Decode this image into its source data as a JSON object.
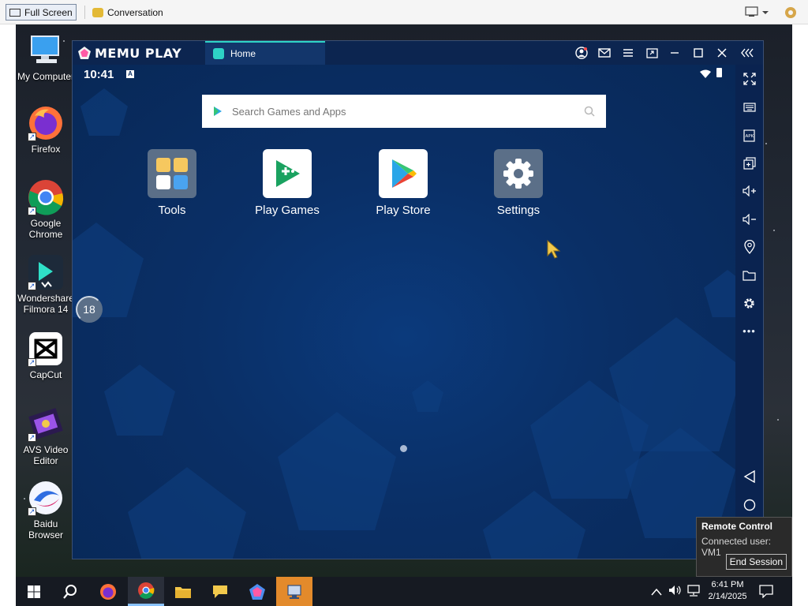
{
  "viewer_bar": {
    "fullscreen_label": "Full Screen",
    "conversation_label": "Conversation"
  },
  "desktop": {
    "icons": [
      {
        "label": "My Computer",
        "icon": "monitor-icon"
      },
      {
        "label": "Firefox",
        "icon": "firefox-icon"
      },
      {
        "label": "Google Chrome",
        "icon": "chrome-icon"
      },
      {
        "label": "Wondershare Filmora 14",
        "icon": "filmora-icon"
      },
      {
        "label": "CapCut",
        "icon": "capcut-icon"
      },
      {
        "label": "AVS Video Editor",
        "icon": "avs-icon"
      },
      {
        "label": "Baidu Browser",
        "icon": "baidu-icon"
      }
    ]
  },
  "memu": {
    "logo_text": "MEMU PLAY",
    "tab_label": "Home",
    "status_time": "10:41",
    "search_placeholder": "Search Games and Apps",
    "apps": [
      {
        "label": "Tools",
        "icon": "tools-icon"
      },
      {
        "label": "Play Games",
        "icon": "play-games-icon"
      },
      {
        "label": "Play Store",
        "icon": "play-store-icon"
      },
      {
        "label": "Settings",
        "icon": "settings-gear-icon"
      }
    ],
    "progress_text": "18",
    "progress_value": 0.18
  },
  "remote_control": {
    "title": "Remote Control",
    "connected": "Connected user: VM1",
    "end_button": "End Session"
  },
  "taskbar": {
    "time": "6:41 PM",
    "date": "2/14/2025"
  },
  "colors": {
    "memu_bg": "#0a2f66",
    "memu_title": "#0c2550",
    "tab_accent": "#2ed3c6",
    "taskbar": "#161a22"
  }
}
